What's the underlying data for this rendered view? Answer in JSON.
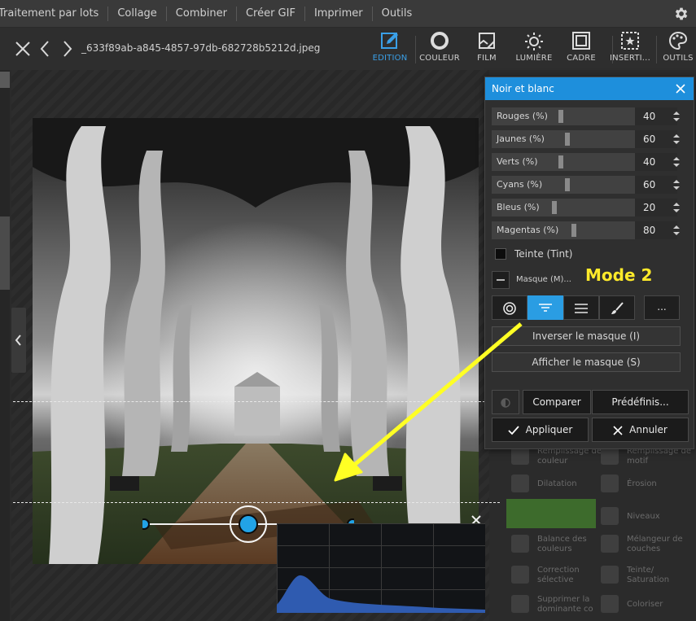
{
  "menubar": {
    "items": [
      "Traitement par lots",
      "Collage",
      "Combiner",
      "Créer GIF",
      "Imprimer",
      "Outils"
    ]
  },
  "toolbar": {
    "filename": "_633f89ab-a845-4857-97db-682728b5212d.jpeg",
    "tools": [
      {
        "label": "EDITION",
        "icon": "edit-icon",
        "active": true
      },
      {
        "label": "COULEUR",
        "icon": "color-circle-icon"
      },
      {
        "label": "FILM",
        "icon": "film-icon"
      },
      {
        "label": "LUMIÈRE",
        "icon": "sun-icon"
      },
      {
        "label": "CADRE",
        "icon": "frame-icon"
      },
      {
        "label": "INSERTI...",
        "icon": "insert-icon"
      },
      {
        "label": "OUTILS",
        "icon": "palette-icon"
      }
    ]
  },
  "panel": {
    "title": "Noir et blanc",
    "sliders": [
      {
        "label": "Rouges (%)",
        "value": "40"
      },
      {
        "label": "Jaunes (%)",
        "value": "60"
      },
      {
        "label": "Verts (%)",
        "value": "40"
      },
      {
        "label": "Cyans (%)",
        "value": "60"
      },
      {
        "label": "Bleus (%)",
        "value": "20"
      },
      {
        "label": "Magentas (%)",
        "value": "80"
      }
    ],
    "tint_label": "Teinte (Tint)",
    "mask_label": "Masque (M)...",
    "more_label": "...",
    "invert_mask": "Inverser le masque (I)",
    "show_mask": "Afficher le masque (S)",
    "compare": "Comparer",
    "presets": "Prédéfinis...",
    "apply": "Appliquer",
    "cancel": "Annuler"
  },
  "background_functions": [
    "Remplissage de couleur",
    "Remplissage de motif",
    "Dilatation",
    "Érosion",
    "Niveaux",
    "Balance des couleurs",
    "Mélangeur de couches",
    "Correction sélective",
    "Teinte/ Saturation",
    "Supprimer la dominante co",
    "Coloriser"
  ],
  "annotation": {
    "text": "Mode 2",
    "color": "#ffea2a"
  },
  "colors": {
    "accent": "#1e8fdc",
    "active_tool": "#3aa0e8"
  }
}
